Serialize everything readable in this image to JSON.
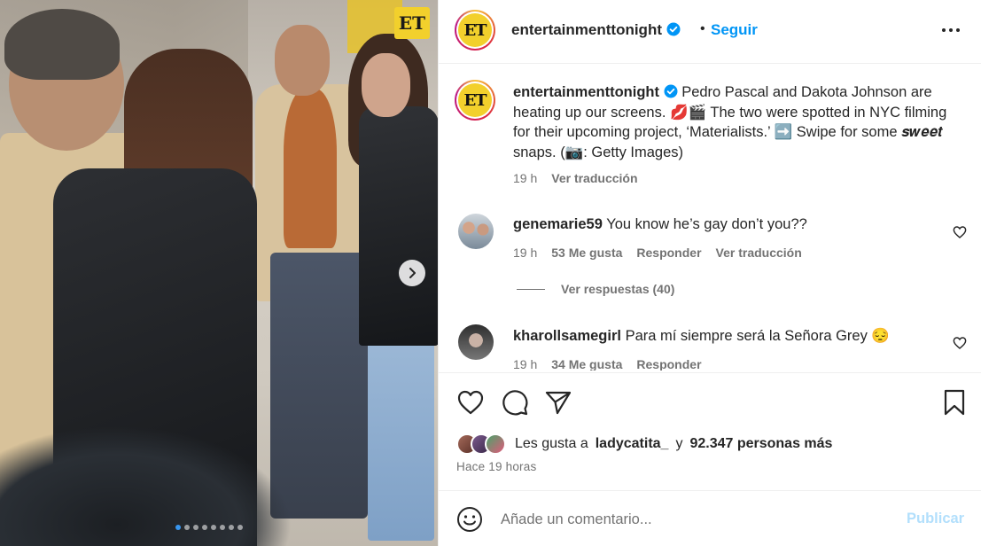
{
  "post": {
    "account": "entertainmenttonight",
    "avatar_text": "ET",
    "follow_label": "Seguir",
    "separator": "•",
    "caption": {
      "text": "Pedro Pascal and Dakota Johnson are heating up our screens. 💋🎬 The two were spotted in NYC filming for their upcoming project, ‘Materialists.’ ➡️ Swipe for some 𝒔𝒘𝒆𝒆𝒕 snaps. (📷: Getty Images)",
      "time": "19 h",
      "translate": "Ver traducción"
    }
  },
  "photo": {
    "badge_text": "ET",
    "carousel_total": 8,
    "carousel_active": 1
  },
  "comments": [
    {
      "user": "genemarie59",
      "text": "You know he’s gay don’t you??",
      "time": "19 h",
      "likes": "53 Me gusta",
      "reply": "Responder",
      "translate": "Ver traducción",
      "replies_label": "Ver respuestas (40)"
    },
    {
      "user": "kharollsamegirl",
      "text": "Para mí siempre será la Señora Grey 😔",
      "time": "19 h",
      "likes": "34 Me gusta",
      "reply": "Responder"
    }
  ],
  "likes": {
    "prefix": "Les gusta a",
    "user": "ladycatita_",
    "conj": "y",
    "count": "92.347 personas más"
  },
  "posted_ago": "Hace 19 horas",
  "add_comment": {
    "placeholder": "Añade un comentario...",
    "publish": "Publicar"
  },
  "colors": {
    "accent": "#0095f6",
    "publish_disabled": "#b2dffc",
    "muted": "#737373",
    "text": "#262626"
  },
  "icons": [
    "verified-icon",
    "more-options-icon",
    "heart-icon",
    "comment-icon",
    "share-icon",
    "bookmark-icon",
    "emoji-icon",
    "next-arrow-icon"
  ]
}
